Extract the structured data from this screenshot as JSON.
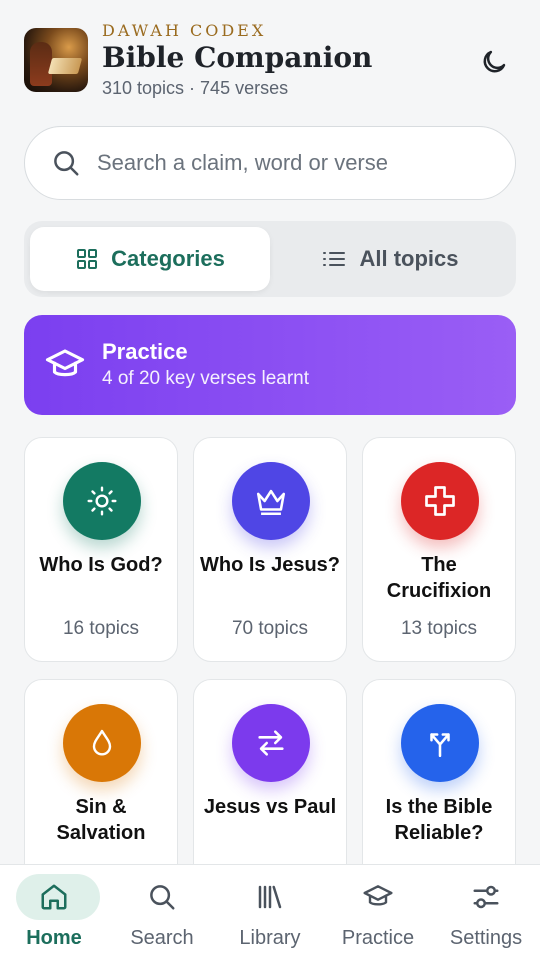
{
  "header": {
    "brand": "DAWAH CODEX",
    "title": "Bible Companion",
    "subtitle": "310 topics · 745 verses"
  },
  "search": {
    "placeholder": "Search a claim, word or verse"
  },
  "view_toggle": {
    "categories": "Categories",
    "all_topics": "All topics",
    "selected": "Categories"
  },
  "practice_banner": {
    "title": "Practice",
    "progress_text": "4 of 20 key verses learnt",
    "learnt": 4,
    "total": 20
  },
  "categories": [
    {
      "name": "Who Is God?",
      "count": "16 topics",
      "icon": "sun-icon",
      "color": "#137a63"
    },
    {
      "name": "Who Is Jesus?",
      "count": "70 topics",
      "icon": "crown-icon",
      "color": "#4f46e5"
    },
    {
      "name": "The Crucifixion",
      "count": "13 topics",
      "icon": "cross-icon",
      "color": "#dc2626"
    },
    {
      "name": "Sin & Salvation",
      "count": "",
      "icon": "drop-icon",
      "color": "#d97706"
    },
    {
      "name": "Jesus vs Paul",
      "count": "",
      "icon": "swap-arrows-icon",
      "color": "#7c3aed"
    },
    {
      "name": "Is the Bible Reliable?",
      "count": "",
      "icon": "fork-arrows-icon",
      "color": "#2563eb"
    }
  ],
  "tabbar": {
    "items": [
      {
        "label": "Home",
        "icon": "home-icon"
      },
      {
        "label": "Search",
        "icon": "search-icon"
      },
      {
        "label": "Library",
        "icon": "library-icon"
      },
      {
        "label": "Practice",
        "icon": "graduation-cap-icon"
      },
      {
        "label": "Settings",
        "icon": "sliders-icon"
      }
    ],
    "active": "Home"
  },
  "colors": {
    "accent": "#1c6e5c",
    "practice_start": "#7b3ff0",
    "practice_end": "#9a5ef5"
  }
}
